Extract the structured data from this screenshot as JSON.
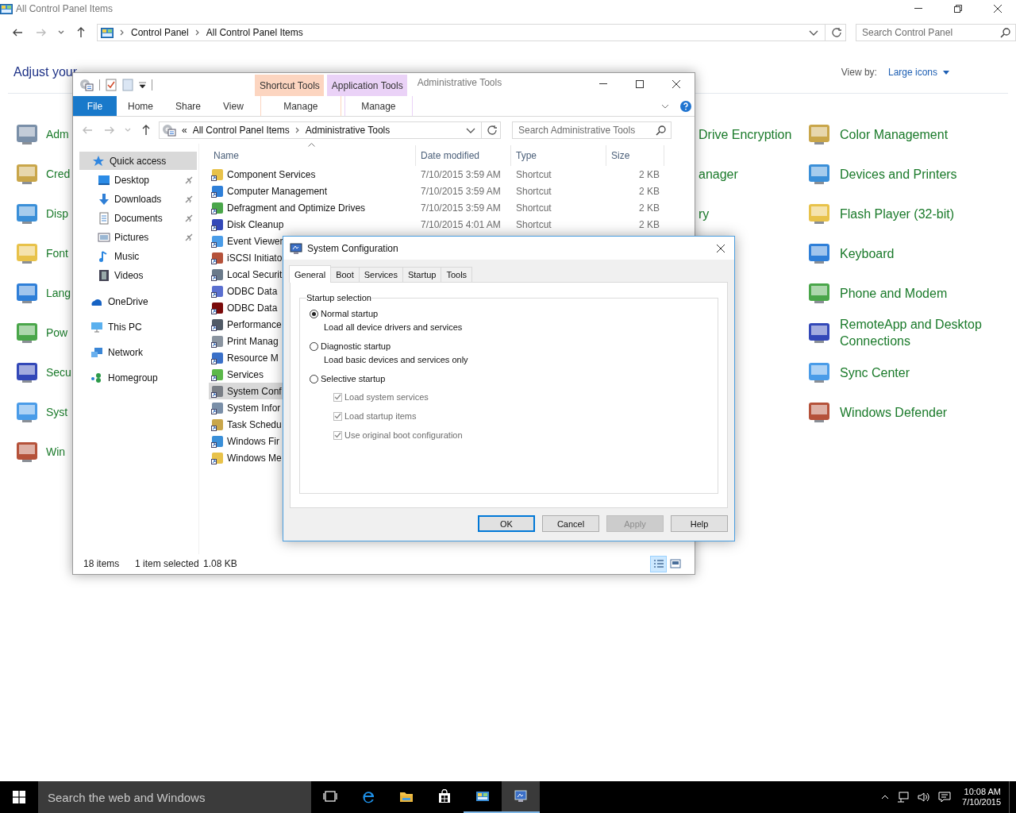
{
  "control_panel": {
    "title": "All Control Panel Items",
    "breadcrumbs": [
      "Control Panel",
      "All Control Panel Items"
    ],
    "search": {
      "placeholder": "Search Control Panel"
    },
    "heading": "Adjust your",
    "view_by": {
      "label": "View by:",
      "value": "Large icons"
    },
    "columns": [
      {
        "icons": true,
        "items": [
          {
            "label": "Adm"
          },
          {
            "label": "Cred"
          },
          {
            "label": "Disp"
          },
          {
            "label": "Font"
          },
          {
            "label": "Lang"
          },
          {
            "label": "Pow"
          },
          {
            "label": "Secu"
          },
          {
            "label": "Syst"
          },
          {
            "label": "Win"
          }
        ]
      },
      {
        "icons": false,
        "items": [
          {
            "label": "Drive Encryption"
          },
          {
            "label": "anager"
          },
          {
            "label": "ry"
          }
        ]
      },
      {
        "icons": true,
        "items": [
          {
            "label": "Color Management"
          },
          {
            "label": "Devices and Printers"
          },
          {
            "label": "Flash Player (32-bit)"
          },
          {
            "label": "Keyboard"
          },
          {
            "label": "Phone and Modem"
          },
          {
            "label": "RemoteApp and Desktop Connections"
          },
          {
            "label": "Sync Center"
          },
          {
            "label": "Windows Defender"
          }
        ]
      }
    ]
  },
  "explorer": {
    "title": "Administrative Tools",
    "context_groups": [
      {
        "label": "Shortcut Tools",
        "color": "#fcd5c0",
        "tab": "Manage"
      },
      {
        "label": "Application Tools",
        "color": "#ead2f7",
        "tab": "Manage"
      }
    ],
    "tabs": [
      {
        "label": "File",
        "kind": "file"
      },
      {
        "label": "Home",
        "kind": "tab"
      },
      {
        "label": "Share",
        "kind": "tab"
      },
      {
        "label": "View",
        "kind": "tab"
      }
    ],
    "address": {
      "overflow": "«",
      "crumbs": [
        "All Control Panel Items",
        "Administrative Tools"
      ]
    },
    "search": {
      "placeholder": "Search Administrative Tools"
    },
    "nav": [
      {
        "label": "Quick access",
        "selected": true,
        "children": [
          {
            "label": "Desktop",
            "pinned": true
          },
          {
            "label": "Downloads",
            "pinned": true
          },
          {
            "label": "Documents",
            "pinned": true
          },
          {
            "label": "Pictures",
            "pinned": true
          },
          {
            "label": "Music",
            "pinned": false
          },
          {
            "label": "Videos",
            "pinned": false
          }
        ]
      },
      {
        "label": "OneDrive",
        "selected": false
      },
      {
        "label": "This PC",
        "selected": false
      },
      {
        "label": "Network",
        "selected": false
      },
      {
        "label": "Homegroup",
        "selected": false
      }
    ],
    "columns": [
      {
        "label": "Name",
        "sorted": true
      },
      {
        "label": "Date modified",
        "sorted": false
      },
      {
        "label": "Type",
        "sorted": false
      },
      {
        "label": "Size",
        "sorted": false
      }
    ],
    "files": [
      {
        "name": "Component Services",
        "date": "7/10/2015 3:59 AM",
        "type": "Shortcut",
        "size": "2 KB",
        "selected": false
      },
      {
        "name": "Computer Management",
        "date": "7/10/2015 3:59 AM",
        "type": "Shortcut",
        "size": "2 KB",
        "selected": false
      },
      {
        "name": "Defragment and Optimize Drives",
        "date": "7/10/2015 3:59 AM",
        "type": "Shortcut",
        "size": "2 KB",
        "selected": false
      },
      {
        "name": "Disk Cleanup",
        "date": "7/10/2015 4:01 AM",
        "type": "Shortcut",
        "size": "2 KB",
        "selected": false
      },
      {
        "name": "Event Viewer",
        "selected": false
      },
      {
        "name": "iSCSI Initiato",
        "selected": false
      },
      {
        "name": "Local Securit",
        "selected": false
      },
      {
        "name": "ODBC Data",
        "selected": false
      },
      {
        "name": "ODBC Data",
        "selected": false
      },
      {
        "name": "Performance",
        "selected": false
      },
      {
        "name": "Print Manag",
        "selected": false
      },
      {
        "name": "Resource M",
        "selected": false
      },
      {
        "name": "Services",
        "selected": false
      },
      {
        "name": "System Conf",
        "selected": true
      },
      {
        "name": "System Infor",
        "selected": false
      },
      {
        "name": "Task Schedu",
        "selected": false
      },
      {
        "name": "Windows Fir",
        "selected": false
      },
      {
        "name": "Windows Me",
        "selected": false
      }
    ],
    "status": {
      "count": "18 items",
      "selection": "1 item selected",
      "size": "1.08 KB"
    },
    "views": [
      {
        "kind": "details",
        "selected": true
      },
      {
        "kind": "tiles",
        "selected": false
      }
    ]
  },
  "dialog": {
    "title": "System Configuration",
    "tabs": [
      {
        "label": "General",
        "selected": true
      },
      {
        "label": "Boot",
        "selected": false
      },
      {
        "label": "Services",
        "selected": false
      },
      {
        "label": "Startup",
        "selected": false
      },
      {
        "label": "Tools",
        "selected": false
      }
    ],
    "group": "Startup selection",
    "options": [
      {
        "label": "Normal startup",
        "description": "Load all device drivers and services",
        "selected": true
      },
      {
        "label": "Diagnostic startup",
        "description": "Load basic devices and services only",
        "selected": false
      },
      {
        "label": "Selective startup",
        "selected": false
      }
    ],
    "checks": [
      {
        "label": "Load system services",
        "checked": true,
        "disabled": true
      },
      {
        "label": "Load startup items",
        "checked": true,
        "disabled": true
      },
      {
        "label": "Use original boot configuration",
        "checked": true,
        "disabled": true
      }
    ],
    "buttons": [
      {
        "label": "OK",
        "default": true,
        "disabled": false
      },
      {
        "label": "Cancel",
        "default": false,
        "disabled": false
      },
      {
        "label": "Apply",
        "default": false,
        "disabled": true
      },
      {
        "label": "Help",
        "default": false,
        "disabled": false
      }
    ]
  },
  "taskbar": {
    "search": {
      "placeholder": "Search the web and Windows"
    },
    "apps": [
      {
        "kind": "taskview",
        "running": false,
        "active": false
      },
      {
        "kind": "browser",
        "running": false,
        "active": false
      },
      {
        "kind": "folder",
        "running": false,
        "active": false
      },
      {
        "kind": "store",
        "running": false,
        "active": false
      },
      {
        "kind": "controlpanel",
        "running": true,
        "active": false
      },
      {
        "kind": "sysconfig",
        "running": true,
        "active": true
      }
    ],
    "time": "10:08 AM",
    "date": "7/10/2015"
  }
}
